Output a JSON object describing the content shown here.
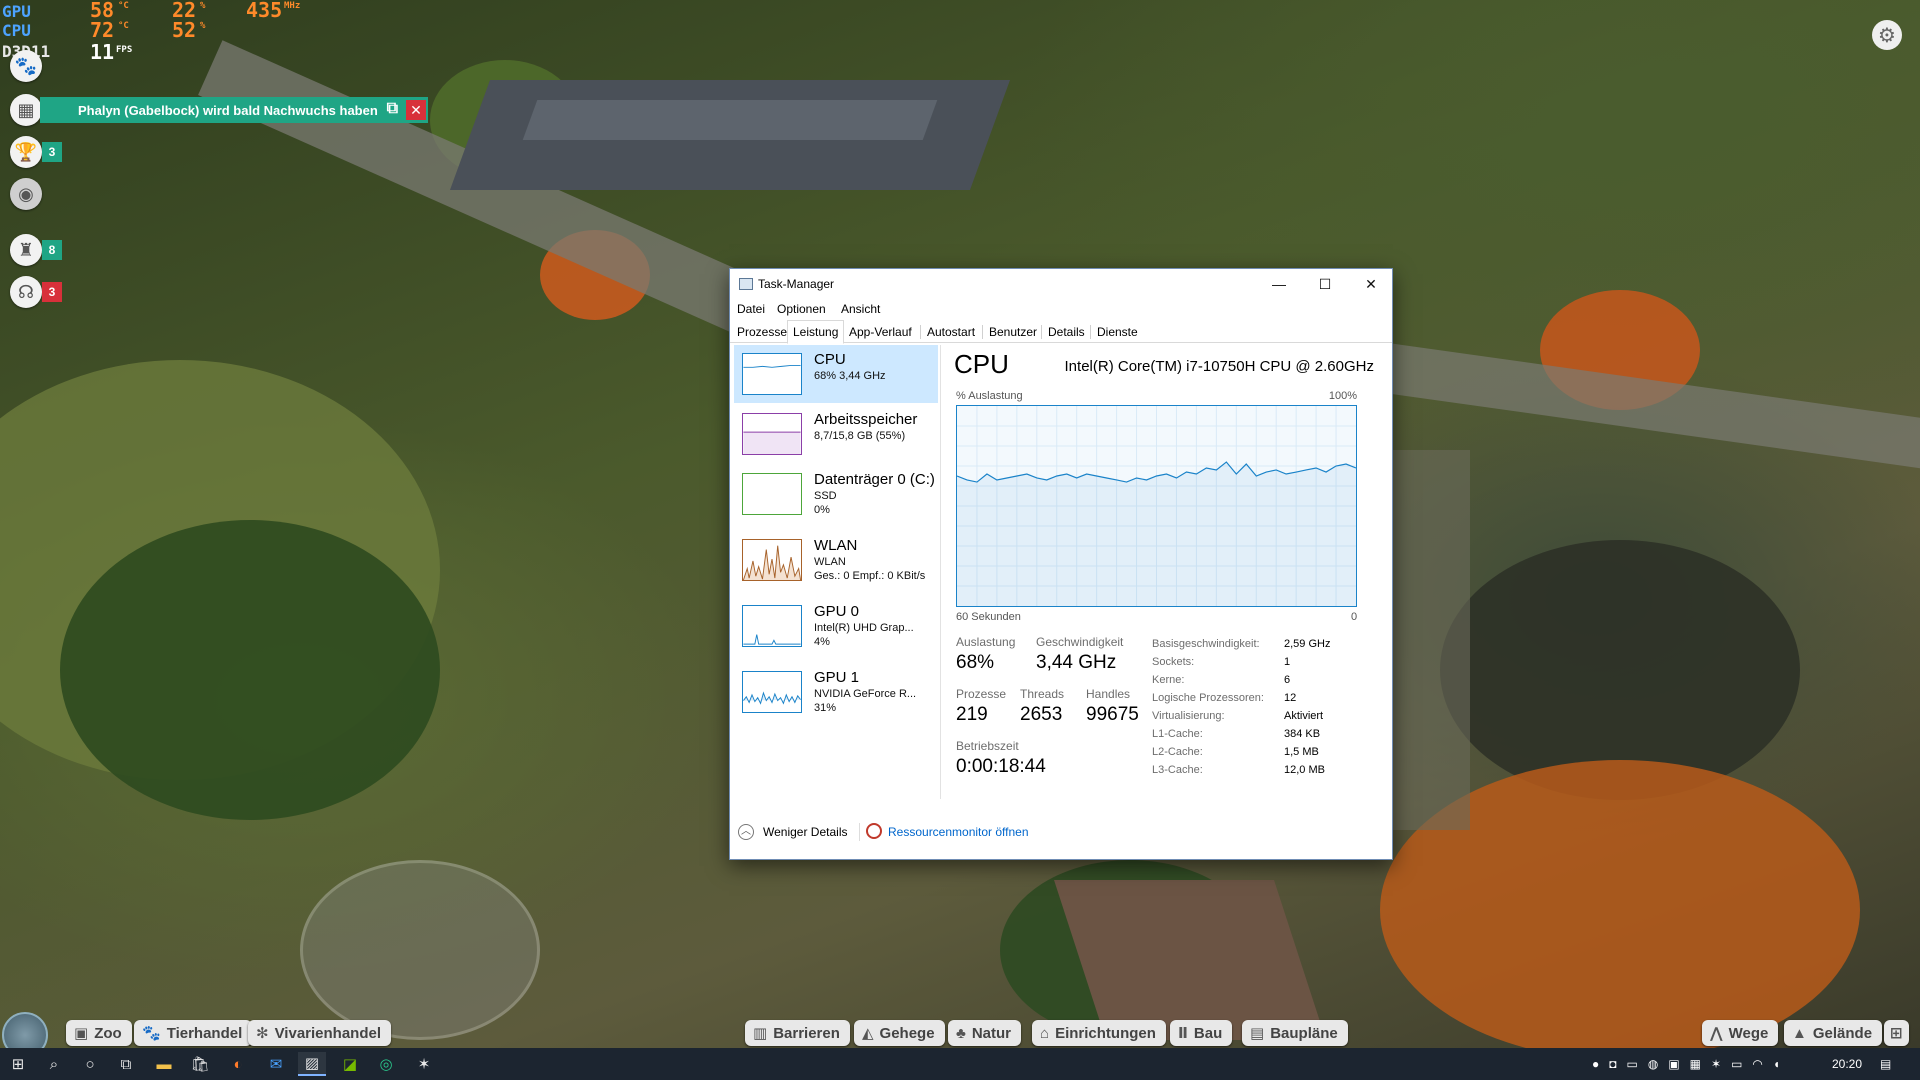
{
  "overlay": {
    "rows": [
      {
        "label": "GPU",
        "temp": "58",
        "temp_unit": "°C",
        "load": "22",
        "load_unit": "%",
        "clock": "435",
        "clock_unit": "MHz"
      },
      {
        "label": "CPU",
        "temp": "72",
        "temp_unit": "°C",
        "load": "52",
        "load_unit": "%"
      },
      {
        "label": "D3D11",
        "fps": "11",
        "fps_unit": "FPS"
      }
    ]
  },
  "hud": {
    "notification": "Phalyn (Gabelbock) wird bald Nachwuchs haben",
    "badges": [
      {
        "icon": "trophy-icon",
        "count": "3",
        "color": "#1fa585"
      },
      {
        "icon": "keeper-icon",
        "count": "8",
        "color": "#1fa585"
      },
      {
        "icon": "guest-icon",
        "count": "3",
        "color": "#d8303a"
      }
    ]
  },
  "gamebar": {
    "left": [
      "Zoo",
      "Tierhandel",
      "Vivarienhandel"
    ],
    "center": [
      "Barrieren",
      "Gehege",
      "Natur",
      "Einrichtungen",
      "Bau",
      "Baupläne"
    ],
    "right": [
      "Wege",
      "Gelände"
    ]
  },
  "taskbar": {
    "clock": "20:20"
  },
  "taskmanager": {
    "title": "Task-Manager",
    "menu": [
      "Datei",
      "Optionen",
      "Ansicht"
    ],
    "tabs": [
      "Prozesse",
      "Leistung",
      "App-Verlauf",
      "Autostart",
      "Benutzer",
      "Details",
      "Dienste"
    ],
    "selected_tab": "Leistung",
    "sidebar": [
      {
        "title": "CPU",
        "l2": "68% 3,44 GHz",
        "l3": "",
        "color": "#1a83c9"
      },
      {
        "title": "Arbeitsspeicher",
        "l2": "8,7/15,8 GB (55%)",
        "l3": "",
        "color": "#8b3fa8"
      },
      {
        "title": "Datenträger 0 (C:)",
        "l2": "SSD",
        "l3": "0%",
        "color": "#4da63a"
      },
      {
        "title": "WLAN",
        "l2": "WLAN",
        "l3": "Ges.: 0 Empf.: 0 KBit/s",
        "color": "#a7622a"
      },
      {
        "title": "GPU 0",
        "l2": "Intel(R) UHD Grap...",
        "l3": "4%",
        "color": "#1a83c9"
      },
      {
        "title": "GPU 1",
        "l2": "NVIDIA GeForce R...",
        "l3": "31%",
        "color": "#1a83c9"
      }
    ],
    "main": {
      "heading": "CPU",
      "model": "Intel(R) Core(TM) i7-10750H CPU @ 2.60GHz",
      "y_label": "% Auslastung",
      "y_max": "100%",
      "x_label": "60 Sekunden",
      "x_min": "0",
      "stats": {
        "auslastung_label": "Auslastung",
        "auslastung": "68%",
        "geschw_label": "Geschwindigkeit",
        "geschw": "3,44 GHz",
        "prozesse_label": "Prozesse",
        "prozesse": "219",
        "threads_label": "Threads",
        "threads": "2653",
        "handles_label": "Handles",
        "handles": "99675",
        "betriebszeit_label": "Betriebszeit",
        "betriebszeit": "0:00:18:44"
      },
      "details": [
        {
          "k": "Basisgeschwindigkeit:",
          "v": "2,59 GHz"
        },
        {
          "k": "Sockets:",
          "v": "1"
        },
        {
          "k": "Kerne:",
          "v": "6"
        },
        {
          "k": "Logische Prozessoren:",
          "v": "12"
        },
        {
          "k": "Virtualisierung:",
          "v": "Aktiviert"
        },
        {
          "k": "L1-Cache:",
          "v": "384 KB"
        },
        {
          "k": "L2-Cache:",
          "v": "1,5 MB"
        },
        {
          "k": "L3-Cache:",
          "v": "12,0 MB"
        }
      ]
    },
    "footer": {
      "less": "Weniger Details",
      "monitor": "Ressourcenmonitor öffnen"
    },
    "cpu_history": [
      65,
      63,
      62,
      66,
      63,
      64,
      65,
      66,
      64,
      63,
      65,
      66,
      64,
      66,
      65,
      64,
      63,
      62,
      64,
      63,
      65,
      66,
      64,
      67,
      66,
      69,
      68,
      72,
      66,
      71,
      65,
      67,
      68,
      66,
      67,
      68,
      69,
      67,
      70,
      71,
      69
    ]
  }
}
